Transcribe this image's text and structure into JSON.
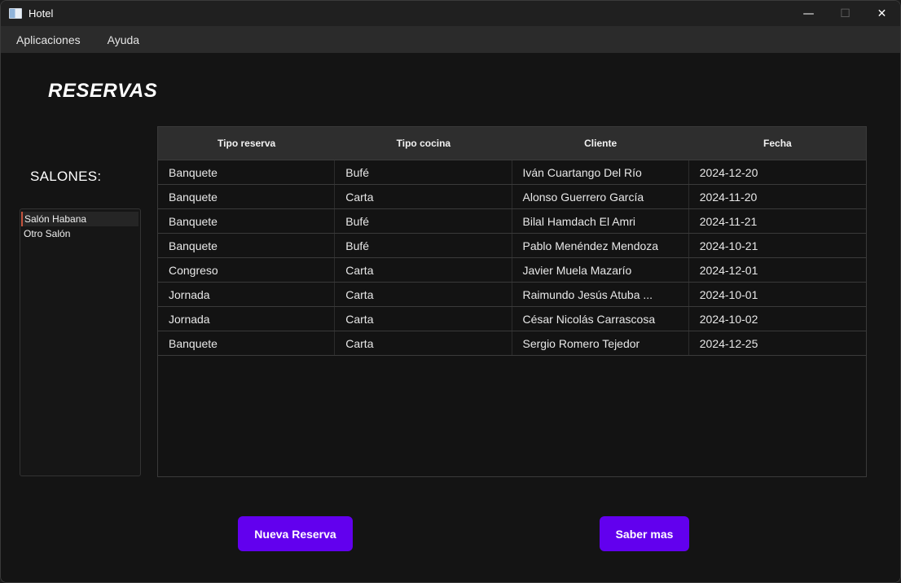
{
  "window": {
    "title": "Hotel"
  },
  "menu": [
    "Aplicaciones",
    "Ayuda"
  ],
  "page": {
    "title": "RESERVAS",
    "salones_label": "SALONES:"
  },
  "salones": [
    "Salón Habana",
    "Otro Salón"
  ],
  "table": {
    "headers": [
      "Tipo reserva",
      "Tipo cocina",
      "Cliente",
      "Fecha"
    ],
    "rows": [
      [
        "Banquete",
        "Bufé",
        "Iván Cuartango Del Río",
        "2024-12-20"
      ],
      [
        "Banquete",
        "Carta",
        "Alonso Guerrero García",
        "2024-11-20"
      ],
      [
        "Banquete",
        "Bufé",
        "Bilal Hamdach El Amri",
        "2024-11-21"
      ],
      [
        "Banquete",
        "Bufé",
        "Pablo Menéndez Mendoza",
        "2024-10-21"
      ],
      [
        "Congreso",
        "Carta",
        "Javier Muela Mazarío",
        "2024-12-01"
      ],
      [
        "Jornada",
        "Carta",
        "Raimundo Jesús Atuba ...",
        "2024-10-01"
      ],
      [
        "Jornada",
        "Carta",
        "César Nicolás Carrascosa",
        "2024-10-02"
      ],
      [
        "Banquete",
        "Carta",
        "Sergio Romero Tejedor",
        "2024-12-25"
      ]
    ]
  },
  "buttons": {
    "nueva_reserva": "Nueva Reserva",
    "saber_mas": "Saber mas"
  },
  "colors": {
    "accent": "#6200ee",
    "selection_marker": "#c5543e"
  }
}
